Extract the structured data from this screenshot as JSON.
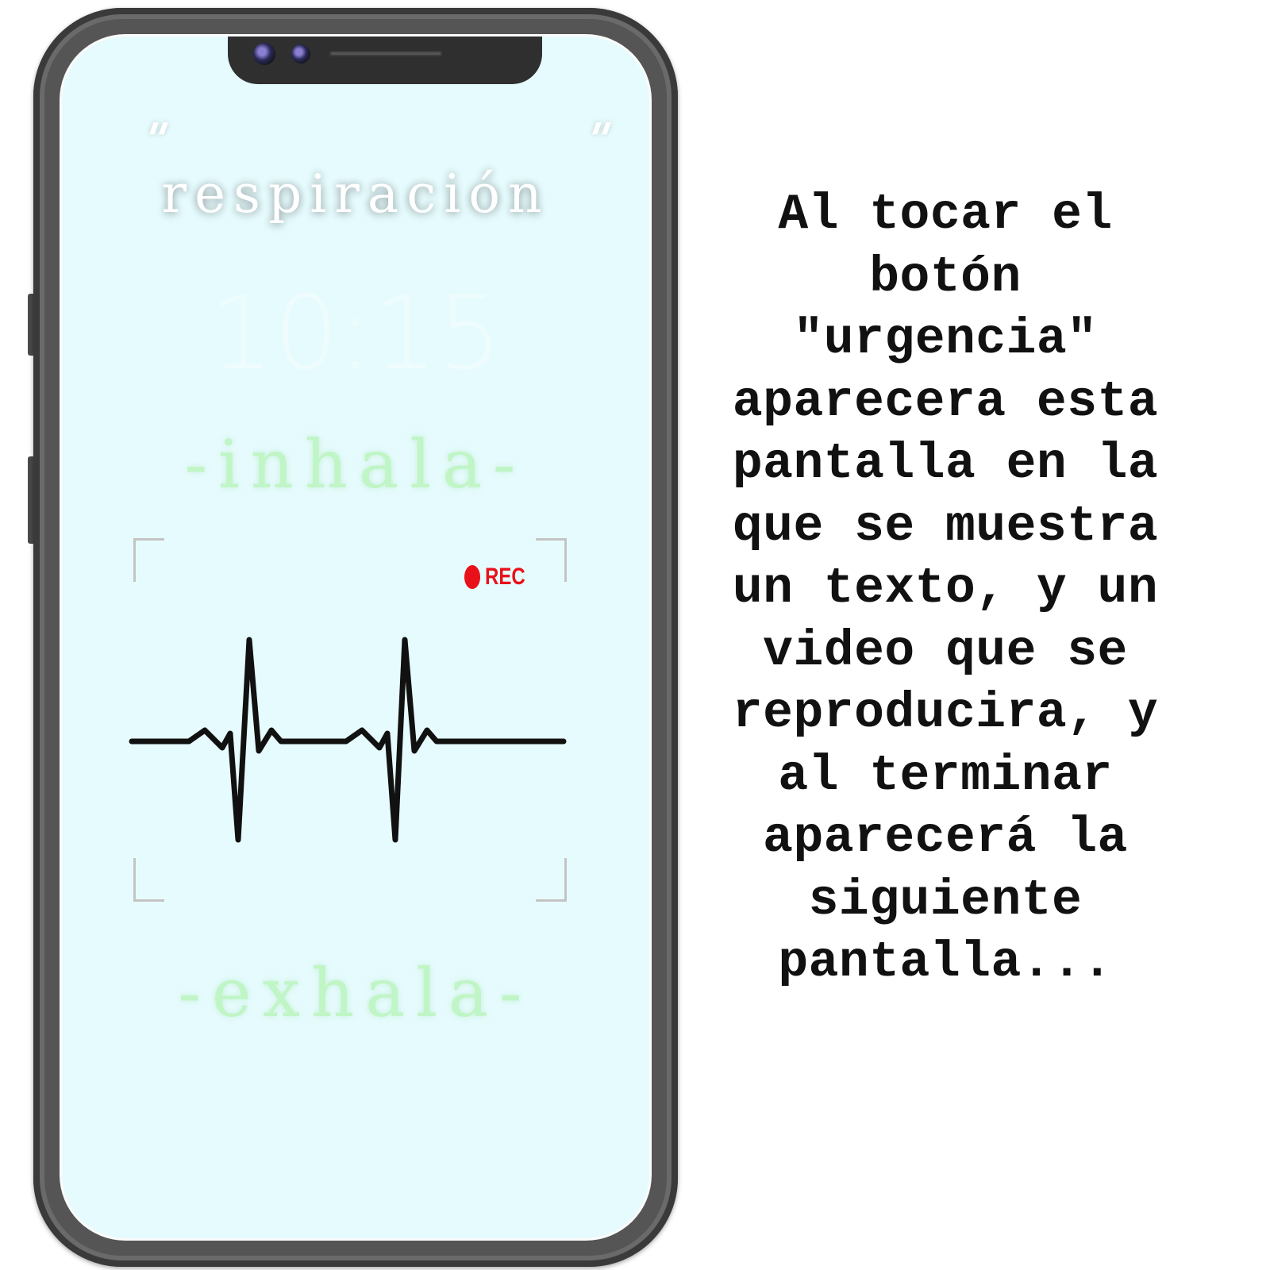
{
  "phone_screen": {
    "title": "respiración",
    "clock": "10:15",
    "inhale_label": "-inhala-",
    "exhale_label": "-exhala-",
    "video": {
      "rec_label": "REC",
      "rec_color": "#e8111a"
    },
    "background_color": "#e6fbfd",
    "breath_text_color": "#c0f5c6"
  },
  "caption": {
    "lines": [
      "Al tocar el",
      "botón",
      "\"urgencia\"",
      "aparecera esta",
      "pantalla en la",
      "que se muestra",
      "un texto, y un",
      "video que se",
      "reproducira, y",
      "al terminar",
      "aparecerá la",
      "siguiente",
      "pantalla..."
    ]
  }
}
